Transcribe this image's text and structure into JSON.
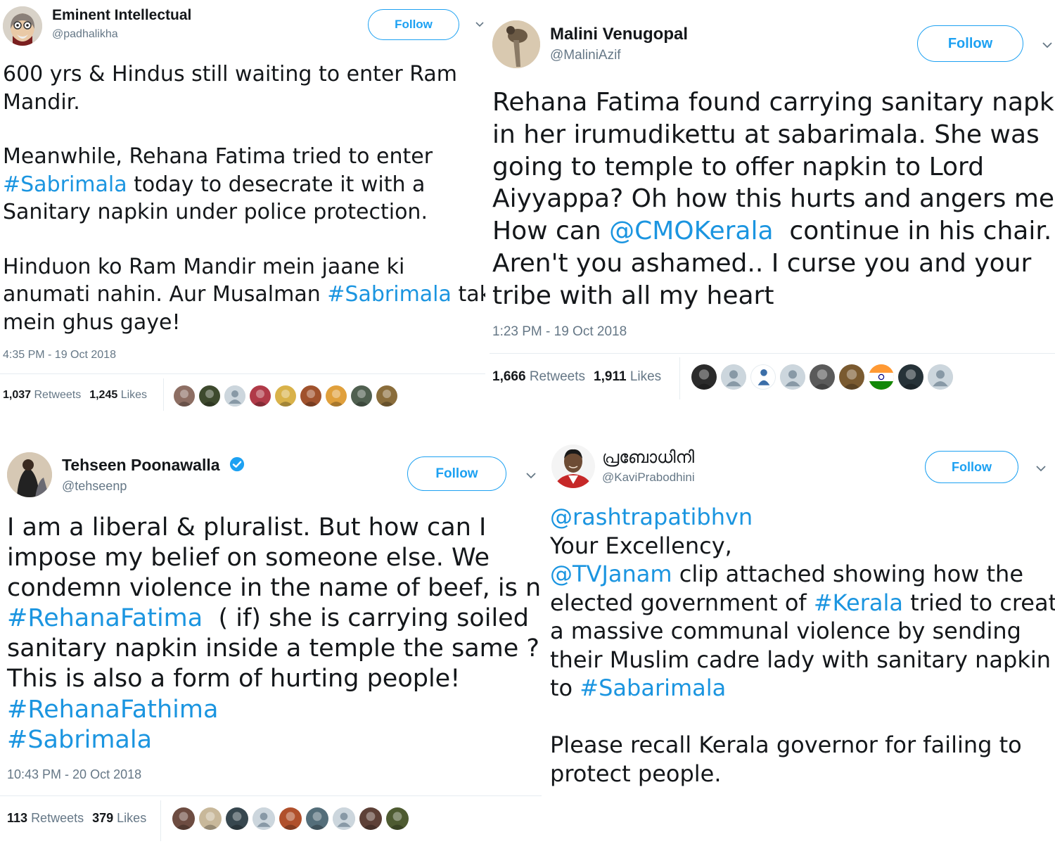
{
  "colors": {
    "accent": "#1da1f2",
    "link": "#1b95e0",
    "muted": "#657786",
    "text": "#14171a",
    "divider": "#e6ecf0"
  },
  "tweets": [
    {
      "author": {
        "name": "Eminent Intellectual",
        "handle": "@padhalikha",
        "verified": false
      },
      "follow_label": "Follow",
      "text_lines": [
        [
          {
            "t": "600 yrs & Hindus still waiting to enter Ram"
          }
        ],
        [
          {
            "t": "Mandir."
          }
        ],
        [],
        [
          {
            "t": "Meanwhile, Rehana Fatima tried to enter"
          }
        ],
        [
          {
            "t": "#Sabrimala",
            "hl": true
          },
          {
            "t": " today to desecrate it with a"
          }
        ],
        [
          {
            "t": "Sanitary napkin under police protection."
          }
        ],
        [],
        [
          {
            "t": "Hinduon ko Ram Mandir mein jaane ki"
          }
        ],
        [
          {
            "t": "anumati nahin. Aur Musalman "
          },
          {
            "t": "#Sabrimala",
            "hl": true
          },
          {
            "t": " tak"
          }
        ],
        [
          {
            "t": "mein ghus gaye!"
          }
        ]
      ],
      "timestamp": "4:35 PM - 19 Oct 2018",
      "retweets_count": "1,037",
      "retweets_label": "Retweets",
      "likes_count": "1,245",
      "likes_label": "Likes",
      "liker_avatars": [
        "#8d6e63",
        "#3e4a2e",
        "#c5cbd0",
        "#b03a48",
        "#d9b24a",
        "#a0522d",
        "#e0a03c",
        "#506050",
        "#8a6d3b"
      ]
    },
    {
      "author": {
        "name": "Malini Venugopal",
        "handle": "@MaliniAzif",
        "verified": false
      },
      "follow_label": "Follow",
      "text_lines": [
        [
          {
            "t": "Rehana Fatima found carrying sanitary napkin"
          }
        ],
        [
          {
            "t": "in her irumudikettu at sabarimala. She was"
          }
        ],
        [
          {
            "t": "going to temple to offer napkin to Lord"
          }
        ],
        [
          {
            "t": "Aiyyappa? Oh how this hurts and angers me."
          }
        ],
        [
          {
            "t": "How can "
          },
          {
            "t": "@CMOKerala",
            "hl": true
          },
          {
            "t": "  continue in his chair."
          }
        ],
        [
          {
            "t": "Aren't you ashamed.. I curse you and your"
          }
        ],
        [
          {
            "t": "tribe with all my heart"
          }
        ]
      ],
      "timestamp": "1:23 PM - 19 Oct 2018",
      "retweets_count": "1,666",
      "retweets_label": "Retweets",
      "likes_count": "1,911",
      "likes_label": "Likes",
      "liker_avatars": [
        "#2b2b2b",
        "#c5cbd0",
        "#ffffff",
        "#c5cbd0",
        "#5a5a5a",
        "#7a5a30",
        "#ff9933",
        "#263238",
        "#c5cbd0"
      ]
    },
    {
      "author": {
        "name": "Tehseen Poonawalla",
        "handle": "@tehseenp",
        "verified": true
      },
      "follow_label": "Follow",
      "text_lines": [
        [
          {
            "t": "I am a liberal & pluralist. But how can I"
          }
        ],
        [
          {
            "t": "impose my belief on someone else. We"
          }
        ],
        [
          {
            "t": "condemn violence in the name of beef, is not"
          }
        ],
        [
          {
            "t": "#RehanaFatima",
            "hl": true
          },
          {
            "t": "  ( if) she is carrying soiled"
          }
        ],
        [
          {
            "t": "sanitary napkin inside a temple the same ?"
          }
        ],
        [
          {
            "t": "This is also a form of hurting people!"
          }
        ],
        [
          {
            "t": "#RehanaFathima",
            "hl": true
          }
        ],
        [
          {
            "t": "#Sabrimala",
            "hl": true
          }
        ]
      ],
      "timestamp": "10:43 PM - 20 Oct 2018",
      "retweets_count": "113",
      "retweets_label": "Retweets",
      "likes_count": "379",
      "likes_label": "Likes",
      "liker_avatars": [
        "#6d4c41",
        "#c8b89a",
        "#37474f",
        "#c5cbd0",
        "#b0502c",
        "#546e7a",
        "#c5cbd0",
        "#5d4037",
        "#4e5b31"
      ]
    },
    {
      "author": {
        "name": "പ്രബോധിനി",
        "handle": "@KaviPrabodhini",
        "verified": false
      },
      "follow_label": "Follow",
      "text_lines": [
        [
          {
            "t": "@rashtrapatibhvn",
            "hl": true
          }
        ],
        [
          {
            "t": "Your Excellency,"
          }
        ],
        [
          {
            "t": "@TVJanam",
            "hl": true
          },
          {
            "t": " clip attached showing how the"
          }
        ],
        [
          {
            "t": "elected government of "
          },
          {
            "t": "#Kerala",
            "hl": true
          },
          {
            "t": " tried to create"
          }
        ],
        [
          {
            "t": "a massive communal violence by sending"
          }
        ],
        [
          {
            "t": "their Muslim cadre lady with sanitary napkin"
          }
        ],
        [
          {
            "t": "to "
          },
          {
            "t": "#Sabarimala",
            "hl": true
          }
        ],
        [],
        [
          {
            "t": "Please recall Kerala governor for failing to"
          }
        ],
        [
          {
            "t": "protect people."
          }
        ]
      ]
    }
  ]
}
